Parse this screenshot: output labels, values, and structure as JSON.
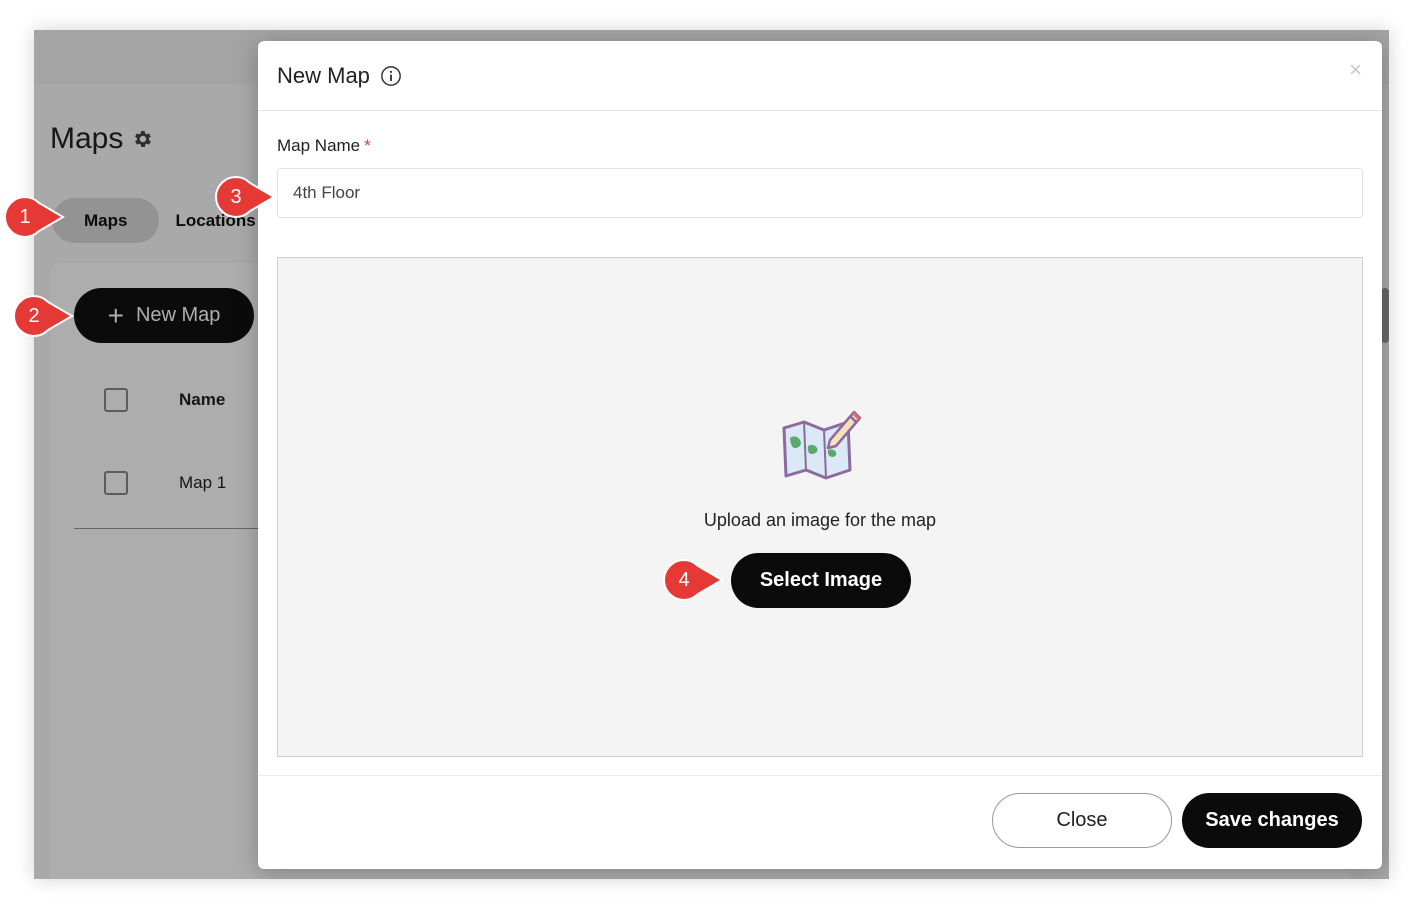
{
  "background": {
    "page_title": "Maps",
    "tabs": [
      {
        "label": "Maps",
        "active": true
      },
      {
        "label": "Locations",
        "active": false
      }
    ],
    "new_map_button": "New Map",
    "table": {
      "header_name": "Name",
      "rows": [
        {
          "name": "Map 1"
        }
      ]
    }
  },
  "modal": {
    "title": "New Map",
    "close_symbol": "×",
    "field_label": "Map Name",
    "required_mark": "*",
    "map_name_value": "4th Floor",
    "upload_text": "Upload an image for the map",
    "select_image_label": "Select Image",
    "close_label": "Close",
    "save_label": "Save changes"
  },
  "callouts": [
    "1",
    "2",
    "3",
    "4"
  ],
  "colors": {
    "callout_red": "#e53935",
    "primary_button": "#0b0b0b",
    "required": "#e53935"
  },
  "icons": [
    "gear-icon",
    "plus-icon",
    "info-icon",
    "close-icon",
    "map-pencil-icon"
  ]
}
